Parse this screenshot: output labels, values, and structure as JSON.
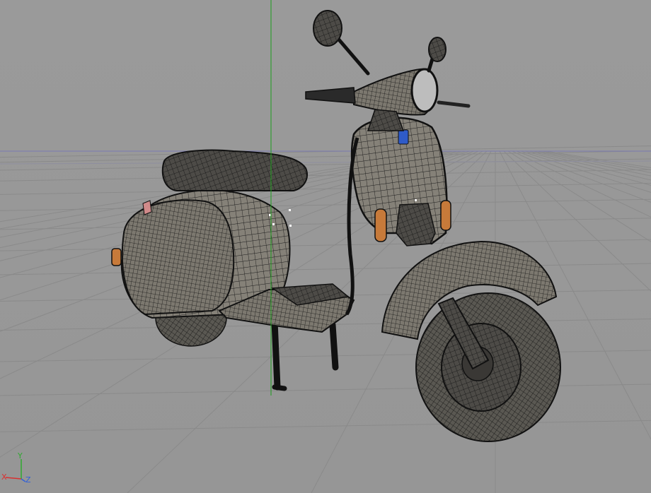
{
  "viewport": {
    "background": "#999999",
    "grid_color": "#8a8a8a",
    "horizon_color": "#7878b4",
    "y_axis_color": "#1e9e1e",
    "grid_visible": true
  },
  "model": {
    "mesh_color": "#848078",
    "wire_color": "#1a1a1a",
    "light_color": "#c77a3a",
    "badge_color": "#2f5bc8",
    "display_mode": "wireframe-on-shaded"
  },
  "axis_gizmo": {
    "x_label": "X",
    "y_label": "Y",
    "z_label": "Z",
    "x_color": "#d93030",
    "y_color": "#2faa2f",
    "z_color": "#3060d8"
  }
}
